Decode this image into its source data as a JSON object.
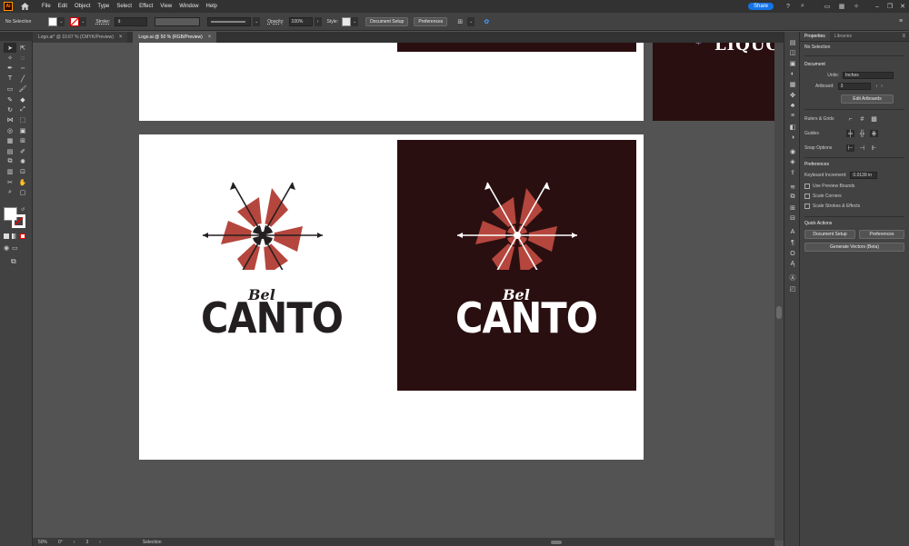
{
  "menubar": {
    "logo": "Ai",
    "items": [
      "File",
      "Edit",
      "Object",
      "Type",
      "Select",
      "Effect",
      "View",
      "Window",
      "Help"
    ],
    "share_label": "Share"
  },
  "controlbar": {
    "selection_text": "No Selection",
    "stroke_label": "Stroke:",
    "opacity_label": "Opacity:",
    "opacity_value": "100%",
    "style_label": "Style:",
    "document_setup_label": "Document Setup",
    "preferences_label": "Preferences"
  },
  "tabs": [
    {
      "label": "Logo.ai* @ 10.67 % (CMYK/Preview)"
    },
    {
      "label": "Logo.ai @ 50 % (RGB/Preview)"
    }
  ],
  "canvas": {
    "logo_word_small": "Bel",
    "logo_word_big": "CANTO",
    "partial_text": "LIQUO",
    "colors": {
      "dark_bg": "#2a0f10",
      "accent_red": "#b5463d",
      "logo_dark": "#231f20",
      "logo_light": "#ffffff"
    }
  },
  "statusbar": {
    "zoom": "50%",
    "angle": "0°",
    "artboard_num": "3",
    "tool": "Selection"
  },
  "properties": {
    "tabs": [
      "Properties",
      "Libraries"
    ],
    "selection_text": "No Selection",
    "document_header": "Document",
    "units_label": "Units:",
    "units_value": "Inches",
    "artboard_label": "Artboard:",
    "artboard_value": "3",
    "edit_artboards_label": "Edit Artboards",
    "rulers_grids_label": "Rulers & Grids",
    "guides_label": "Guides",
    "snap_options_label": "Snap Options",
    "preferences_header": "Preferences",
    "keyboard_increment_label": "Keyboard Increment:",
    "keyboard_increment_value": "0.0139 in",
    "use_preview_bounds_label": "Use Preview Bounds",
    "scale_corners_label": "Scale Corners",
    "scale_strokes_label": "Scale Strokes & Effects",
    "quick_actions_header": "Quick Actions",
    "document_setup_label": "Document Setup",
    "preferences_label": "Preferences",
    "generate_vectors_label": "Generate Vectors (Beta)"
  }
}
